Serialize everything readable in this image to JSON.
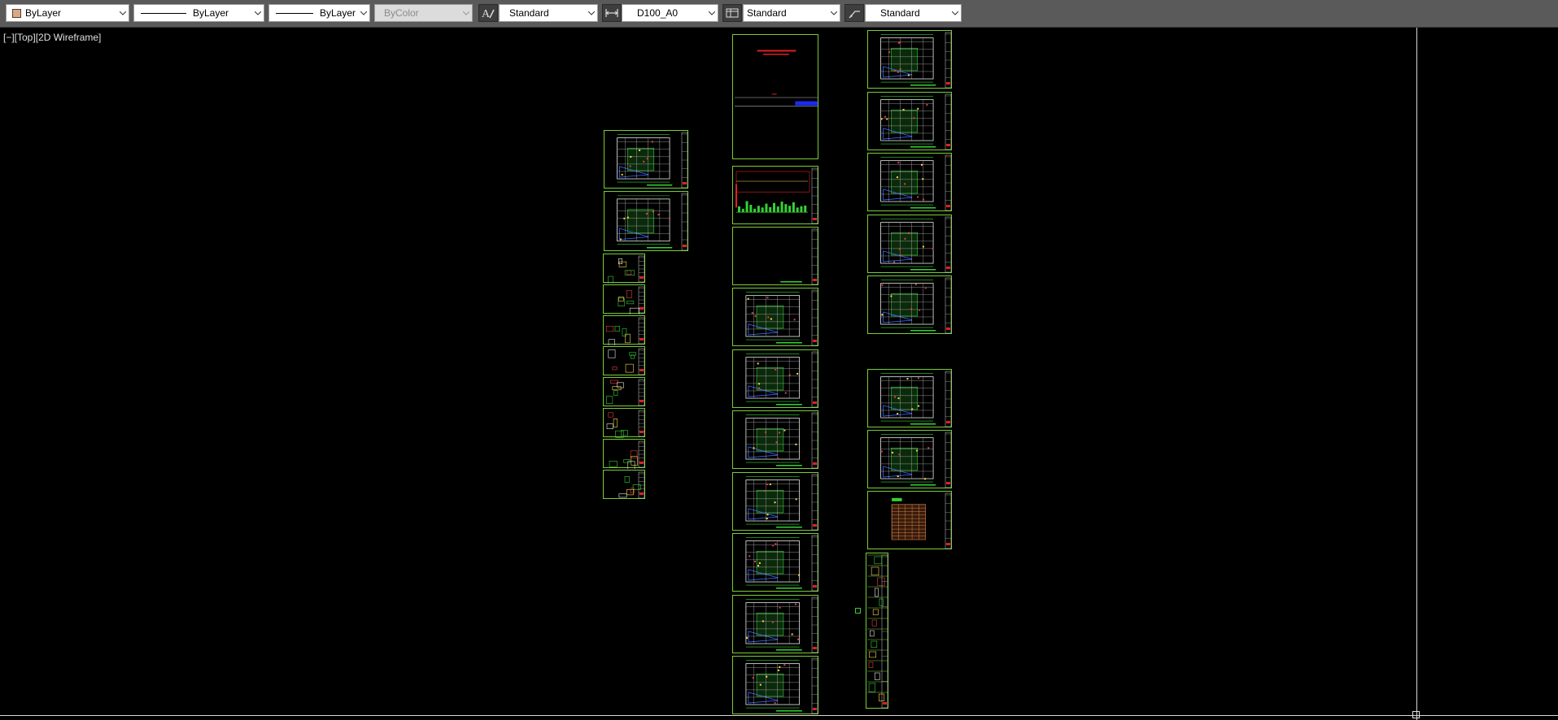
{
  "toolbar": {
    "color": {
      "value": "ByLayer",
      "swatch_color": "#d8a989"
    },
    "linetype": {
      "value": "ByLayer"
    },
    "lineweight": {
      "value": "ByLayer"
    },
    "plotstyle": {
      "value": "ByColor",
      "disabled": true
    },
    "text_style": {
      "icon": "text-style-icon",
      "value": "Standard"
    },
    "dim_style": {
      "icon": "dimension-style-icon",
      "value": "D100_A0"
    },
    "table_style": {
      "icon": "table-style-icon",
      "value": "Standard"
    },
    "mleader_style": {
      "icon": "multileader-style-icon",
      "value": "Standard"
    }
  },
  "viewport": {
    "label": "[−][Top][2D Wireframe]",
    "background": "#000000",
    "frame_color": "#7acc3a"
  }
}
